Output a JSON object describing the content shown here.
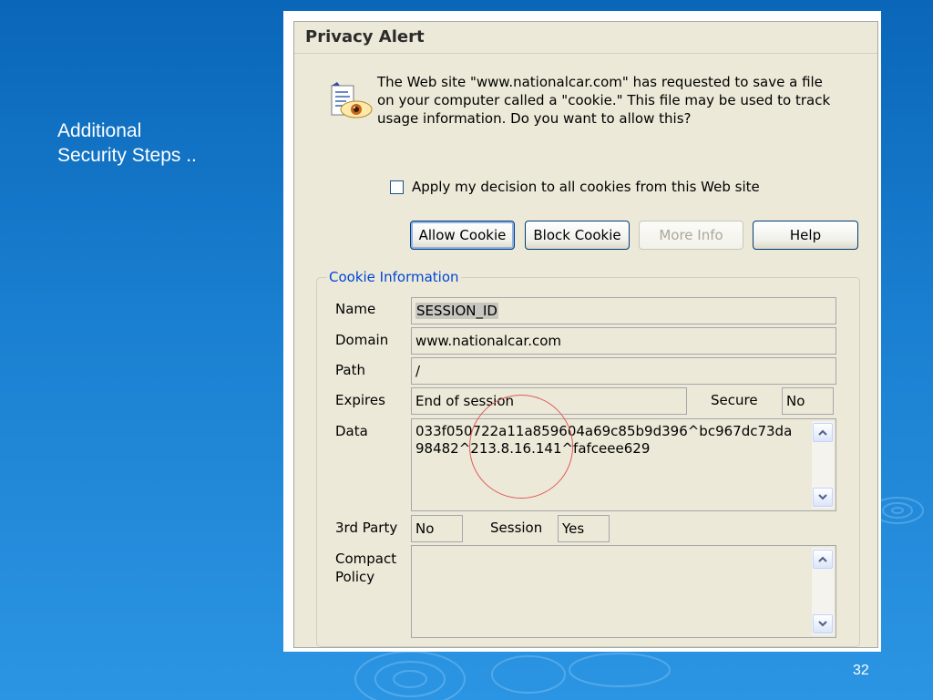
{
  "slide": {
    "title_line1": "Additional",
    "title_line2": "Security Steps ..",
    "page_number": "32"
  },
  "dialog": {
    "title": "Privacy Alert",
    "message_line1": "The Web site \"www.nationalcar.com\" has requested to save a file",
    "message_line2": "on your computer called a \"cookie.\"  This file may be used to track",
    "message_line3": "usage information. Do you want to allow this?",
    "apply_label": "Apply my decision to all cookies from this Web site",
    "apply_checked": false,
    "buttons": {
      "allow": "Allow Cookie",
      "block": "Block Cookie",
      "more": "More Info",
      "help": "Help"
    },
    "cookie_info": {
      "legend": "Cookie Information",
      "labels": {
        "name": "Name",
        "domain": "Domain",
        "path": "Path",
        "expires": "Expires",
        "secure": "Secure",
        "data": "Data",
        "third_party": "3rd Party",
        "session": "Session",
        "compact_line1": "Compact",
        "compact_line2": "Policy"
      },
      "values": {
        "name": "SESSION_ID",
        "domain": "www.nationalcar.com",
        "path": "/",
        "expires": "End of session",
        "secure": "No",
        "data_line1": "033f050722a11a859604a69c85b9d396^bc967dc73da",
        "data_line2": "98482^213.8.16.141^fafceee629",
        "third_party": "No",
        "session": "Yes",
        "compact_policy": ""
      }
    }
  },
  "colors": {
    "background": "#1a7fd0",
    "dialog_face": "#ece9d8",
    "legend_text": "#0046d5",
    "annotation_circle": "#e05a5a",
    "button_border": "#003c74"
  }
}
